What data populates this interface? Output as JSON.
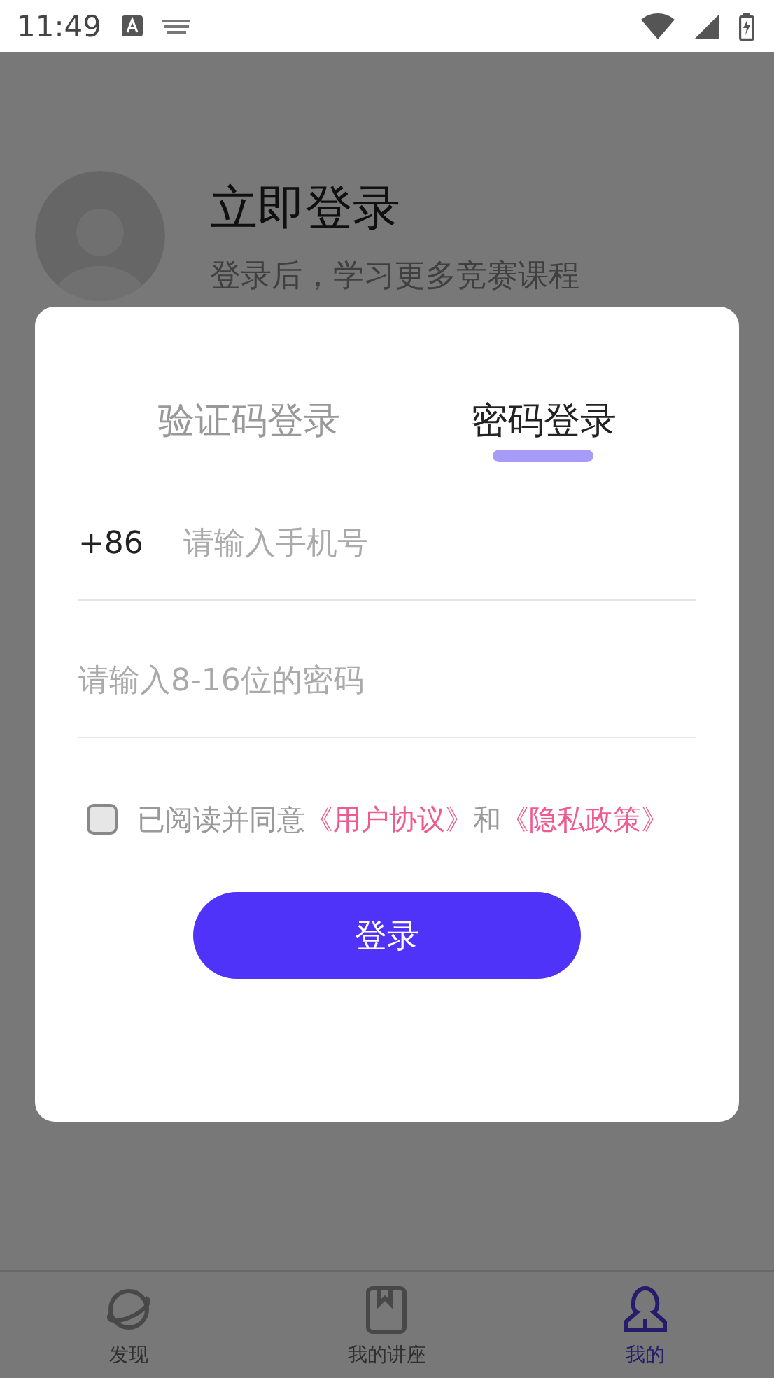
{
  "status_bar": {
    "time": "11:49"
  },
  "profile": {
    "title": "立即登录",
    "subtitle": "登录后，学习更多竞赛课程"
  },
  "dialog": {
    "tabs": [
      {
        "label": "验证码登录",
        "selected": false
      },
      {
        "label": "密码登录",
        "selected": true
      }
    ],
    "phone": {
      "prefix": "+86",
      "placeholder": "请输入手机号"
    },
    "password": {
      "placeholder": "请输入8-16位的密码"
    },
    "agreement": {
      "checked": false,
      "parts": [
        {
          "kind": "text",
          "text": "已阅读并同意"
        },
        {
          "kind": "link",
          "text": "《用户协议》"
        },
        {
          "kind": "text",
          "text": "和"
        },
        {
          "kind": "link",
          "text": "《隐私政策》"
        }
      ]
    },
    "login_button": "登录"
  },
  "bottom_nav": [
    {
      "label": "发现",
      "kind": "planet",
      "selected": false
    },
    {
      "label": "我的讲座",
      "kind": "book",
      "selected": false
    },
    {
      "label": "我的",
      "kind": "person",
      "selected": true
    }
  ]
}
